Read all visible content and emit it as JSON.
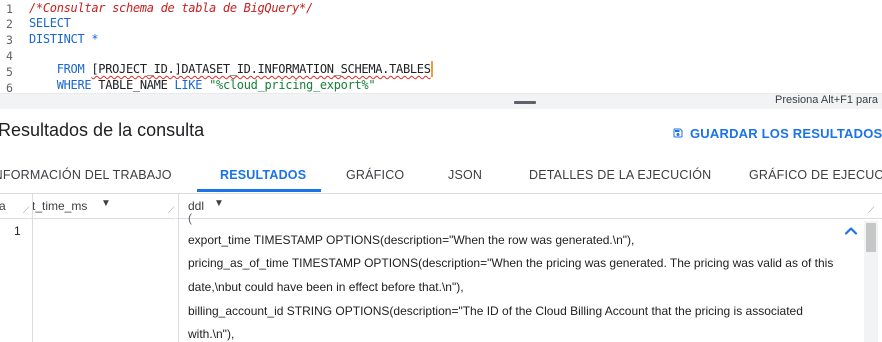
{
  "editor": {
    "line_numbers": [
      "1",
      "2",
      "3",
      "4",
      "5",
      "6"
    ],
    "line1": "/*Consultar schema de tabla de BigQuery*/",
    "line2": "SELECT",
    "line3": "DISTINCT *",
    "line4_kw": "FROM",
    "line4_table": "[PROJECT_ID.]DATASET_ID.INFORMATION_SCHEMA.TABLES",
    "line5_kw1": "WHERE",
    "line5_col": "TABLE_NAME",
    "line5_kw2": "LIKE",
    "line5_str": "\"%cloud_pricing_export%\""
  },
  "status": {
    "hint": "Presiona Alt+F1 para"
  },
  "results": {
    "title": "Resultados de la consulta",
    "save_label": "GUARDAR LOS RESULTADOS"
  },
  "tabs": [
    {
      "label": "INFORMACIÓN DEL TRABAJO"
    },
    {
      "label": "RESULTADOS"
    },
    {
      "label": "GRÁFICO"
    },
    {
      "label": "JSON"
    },
    {
      "label": "DETALLES DE LA EJECUCIÓN"
    },
    {
      "label": "GRÁFICO DE EJECUCIÓN"
    }
  ],
  "table": {
    "columns": [
      {
        "label": "a"
      },
      {
        "label": "t_time_ms"
      },
      {
        "label": "ddl"
      }
    ],
    "row_number": "1",
    "ddl_partial_top": "(",
    "ddl_lines": [
      "  export_time TIMESTAMP OPTIONS(description=\"When the row was generated.\\n\"),",
      "  pricing_as_of_time TIMESTAMP OPTIONS(description=\"When the pricing was generated. The pricing was valid as of this",
      "date,\\nbut could have been in effect before that.\\n\"),",
      "  billing_account_id STRING OPTIONS(description=\"The ID of the Cloud Billing Account that the pricing is associated",
      "with.\\n\"),"
    ]
  },
  "colors": {
    "accent": "#1a73e8",
    "keyword": "#1967d2",
    "comment": "#c5221f",
    "string": "#188038"
  },
  "icons": {
    "save": "save-icon",
    "dropdown": "chevron-down-icon",
    "sort": "sort-caret-icon",
    "collapse": "chevron-up-icon"
  }
}
